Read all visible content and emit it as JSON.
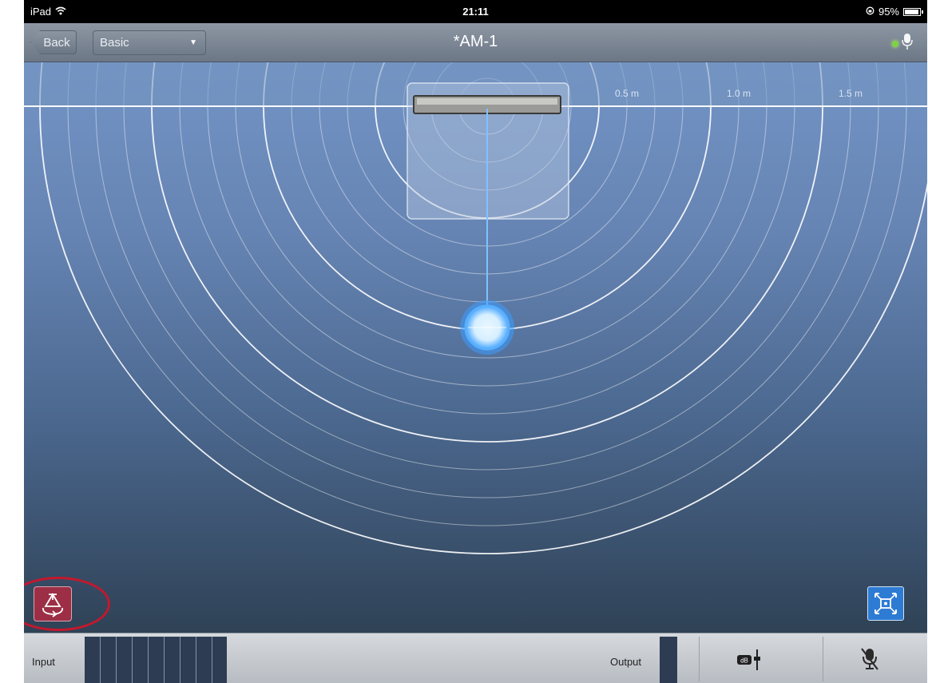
{
  "status_bar": {
    "device": "iPad",
    "time": "21:11",
    "battery": "95%",
    "battery_level": 0.95
  },
  "nav": {
    "back_label": "Back",
    "preset_value": "Basic",
    "title": "*AM-1"
  },
  "canvas": {
    "distance_labels": [
      "0.5 m",
      "1.0 m",
      "1.5 m"
    ]
  },
  "bottom_bar": {
    "input_label": "Input",
    "output_label": "Output",
    "gain_badge": "dB"
  },
  "icons": {
    "wifi": "wifi-icon",
    "rotate": "rotate-icon",
    "fit": "fit-view-icon",
    "mic": "microphone-icon",
    "mute": "mic-mute-icon"
  },
  "colors": {
    "rotate_button": "#9c2f45",
    "fit_button": "#2d7bd3",
    "highlight": "#c3182d",
    "led": "#7fd342"
  }
}
